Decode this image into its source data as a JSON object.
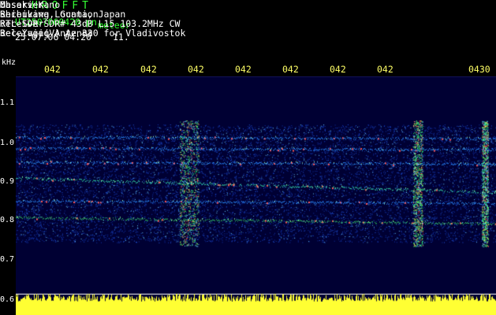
{
  "header": {
    "logo": "HROFFT",
    "filename": "UT2507060420.pn",
    "filename_suffix": "meteor",
    "datetime": "25.07.06 04:20",
    "counter": "11."
  },
  "meta": {
    "observer_label": "Observer",
    "observer_value": "Masaki Kano",
    "location_label": "Receiving Location",
    "location_value": "Shibukawa, Gunma, Japan",
    "receiver_label": "Receiver",
    "receiver_value": "RTL-SDR SDR# 43dB L15 103.2MHz CW",
    "antenna_label": "Receiving Antenna",
    "antenna_value": "3el Yagi(V) Az 330 for Vladivostok",
    "separator": ":"
  },
  "axis": {
    "y_unit": "kHz",
    "y_ticks": [
      "1.1",
      "1.0",
      "0.9",
      "0.8",
      "0.7",
      "0.6"
    ],
    "x_ticks": [
      "042",
      "042",
      "042",
      "042",
      "042",
      "042",
      "042",
      "042",
      "0430"
    ]
  },
  "colors": {
    "header_green": "#33ff33",
    "label_white": "#ffffff",
    "time_yellow": "#ffff66",
    "background": "#000033",
    "waterfall": "#ffff33"
  }
}
